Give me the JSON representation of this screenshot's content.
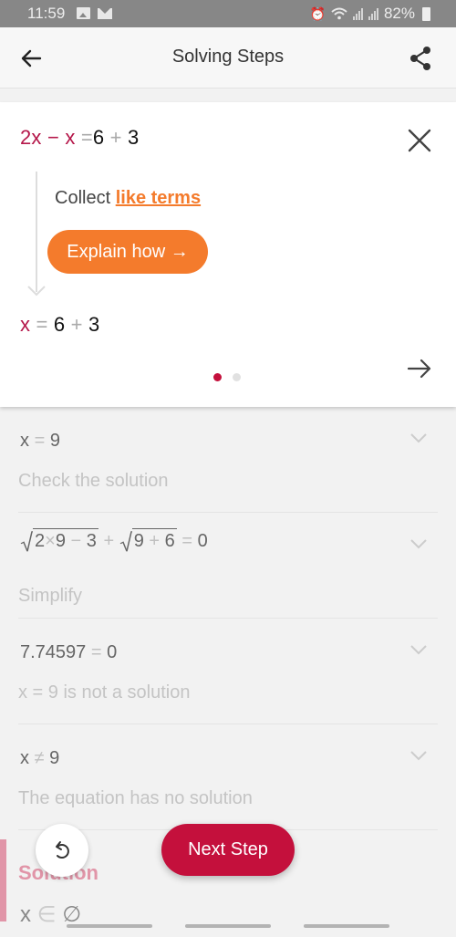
{
  "status_bar": {
    "time": "11:59",
    "battery": "82%",
    "icons": [
      "image-icon",
      "mail-icon",
      "alarm-icon",
      "wifi-icon",
      "signal-icon",
      "signal-icon",
      "battery-icon"
    ]
  },
  "app_bar": {
    "title": "Solving Steps",
    "back_icon": "arrow-left-icon",
    "share_icon": "share-icon"
  },
  "step_card": {
    "equation_top": {
      "a": "2x",
      "minus": "−",
      "b": "x",
      "eq": "=",
      "c": "6",
      "plus": "+",
      "d": "3"
    },
    "description_prefix": "Collect ",
    "description_link": "like terms",
    "explain_button": "Explain how →",
    "equation_bottom": {
      "a": "x",
      "eq": "=",
      "c": "6",
      "plus": "+",
      "d": "3"
    },
    "page_indicator": {
      "current": 1,
      "total": 2
    },
    "colors": {
      "accent": "#c4103c",
      "orange": "#f47b2c",
      "variable": "#b5174a"
    }
  },
  "steps": [
    {
      "equation": {
        "lhs": "x",
        "op": "=",
        "rhs": "9"
      },
      "description": "Check the solution"
    },
    {
      "equation": {
        "rad1": [
          "2",
          "×",
          "9",
          "−",
          "3"
        ],
        "plus": "+",
        "rad2": [
          "9",
          "+",
          "6"
        ],
        "op": "=",
        "rhs": "0"
      },
      "description": "Simplify"
    },
    {
      "equation": {
        "lhs": "7.74597",
        "op": "=",
        "rhs": "0"
      },
      "description": "x = 9 is not a solution"
    },
    {
      "equation": {
        "lhs": "x",
        "op": "≠",
        "rhs": "9"
      },
      "description": "The equation has no solution"
    }
  ],
  "solution": {
    "label": "Solution",
    "lhs": "x",
    "op": "∈",
    "rhs": "∅"
  },
  "buttons": {
    "undo_icon": "undo-icon",
    "next_step": "Next Step"
  }
}
